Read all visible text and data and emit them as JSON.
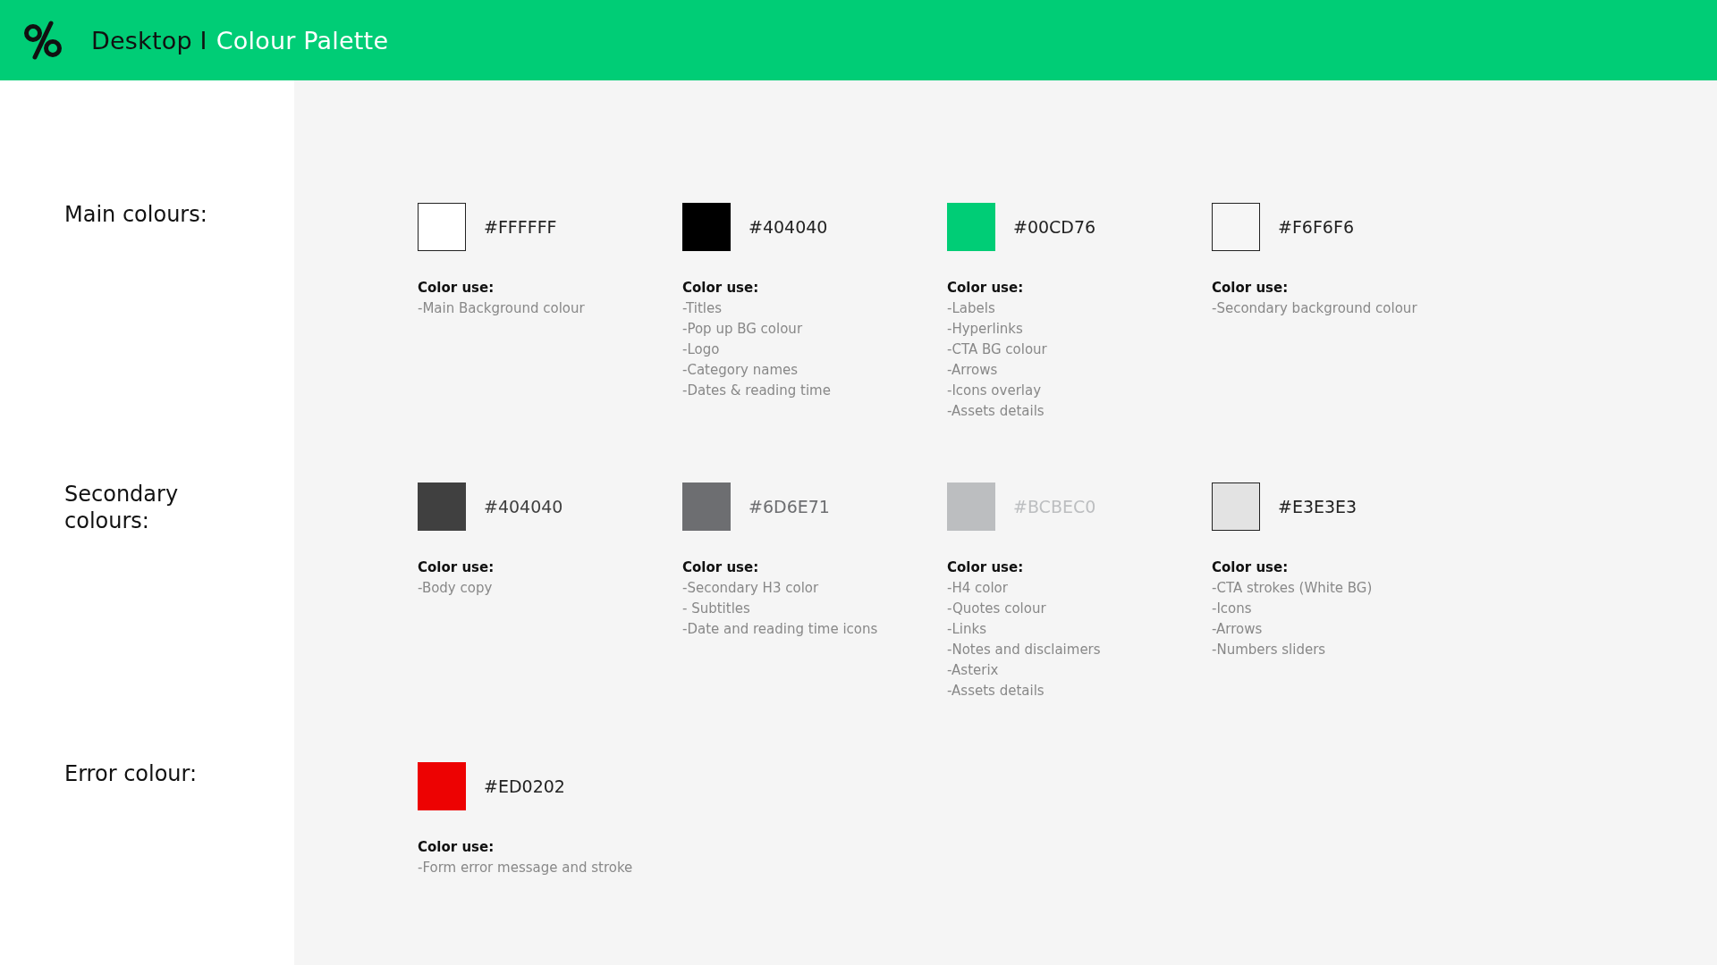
{
  "header": {
    "title_prefix": "Desktop I",
    "title": "Colour Palette"
  },
  "sections": [
    {
      "heading": "Main colours:",
      "swatches": [
        {
          "color": "#ffffff",
          "hex": "#FFFFFF",
          "outlined": true,
          "tinted_label": false,
          "use_heading": "Color use:",
          "uses": [
            "-Main Background colour"
          ]
        },
        {
          "color": "#000000",
          "hex": "#404040",
          "outlined": false,
          "tinted_label": false,
          "use_heading": "Color use:",
          "uses": [
            "-Titles",
            "-Pop up BG colour",
            "-Logo",
            "-Category names",
            "-Dates & reading time"
          ]
        },
        {
          "color": "#00cd76",
          "hex": "#00CD76",
          "outlined": false,
          "tinted_label": false,
          "use_heading": "Color use:",
          "uses": [
            "-Labels",
            "-Hyperlinks",
            "-CTA BG colour",
            "-Arrows",
            "-Icons overlay",
            "-Assets details"
          ]
        },
        {
          "color": "#f6f6f6",
          "hex": "#F6F6F6",
          "outlined": true,
          "tinted_label": false,
          "use_heading": "Color use:",
          "uses": [
            "-Secondary background colour"
          ]
        }
      ]
    },
    {
      "heading": "Secondary colours:",
      "swatches": [
        {
          "color": "#404040",
          "hex": "#404040",
          "outlined": false,
          "tinted_label": true,
          "use_heading": "Color use:",
          "uses": [
            "-Body copy"
          ]
        },
        {
          "color": "#6d6e71",
          "hex": "#6D6E71",
          "outlined": false,
          "tinted_label": true,
          "use_heading": "Color use:",
          "uses": [
            "-Secondary H3 color",
            "- Subtitles",
            "-Date and reading time icons"
          ]
        },
        {
          "color": "#bcbec0",
          "hex": "#BCBEC0",
          "outlined": false,
          "tinted_label": true,
          "use_heading": "Color use:",
          "uses": [
            "-H4 color",
            "-Quotes colour",
            "-Links",
            "-Notes and disclaimers",
            "-Asterix",
            "-Assets details"
          ]
        },
        {
          "color": "#e3e3e3",
          "hex": "#E3E3E3",
          "outlined": true,
          "tinted_label": false,
          "use_heading": "Color use:",
          "uses": [
            "-CTA strokes (White BG)",
            "-Icons",
            "-Arrows",
            "-Numbers sliders"
          ]
        }
      ]
    },
    {
      "heading": "Error colour:",
      "swatches": [
        {
          "color": "#ed0202",
          "hex": "#ED0202",
          "outlined": false,
          "tinted_label": false,
          "use_heading": "Color use:",
          "uses": [
            "-Form error message and stroke"
          ]
        }
      ]
    }
  ]
}
